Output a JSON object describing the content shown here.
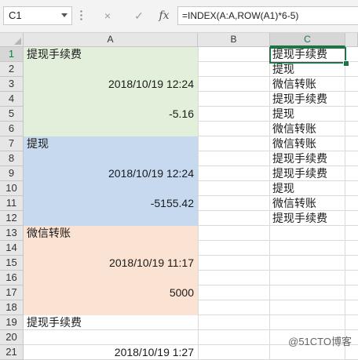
{
  "formula_bar": {
    "name_box": "C1",
    "cancel_icon": "×",
    "enter_icon": "✓",
    "fx_label": "fx",
    "formula": "=INDEX(A:A,ROW(A1)*6-5)"
  },
  "columns": [
    "A",
    "B",
    "C"
  ],
  "rows": [
    "1",
    "2",
    "3",
    "4",
    "5",
    "6",
    "7",
    "8",
    "9",
    "10",
    "11",
    "12",
    "13",
    "14",
    "15",
    "16",
    "17",
    "18",
    "19",
    "20",
    "21"
  ],
  "column_a": [
    {
      "row": 1,
      "text": "提现手续费",
      "align": "left"
    },
    {
      "row": 3,
      "text": "2018/10/19 12:24",
      "align": "right"
    },
    {
      "row": 5,
      "text": "-5.16",
      "align": "right"
    },
    {
      "row": 7,
      "text": "提现",
      "align": "left"
    },
    {
      "row": 9,
      "text": "2018/10/19 12:24",
      "align": "right"
    },
    {
      "row": 11,
      "text": "-5155.42",
      "align": "right"
    },
    {
      "row": 13,
      "text": "微信转账",
      "align": "left"
    },
    {
      "row": 15,
      "text": "2018/10/19 11:17",
      "align": "right"
    },
    {
      "row": 17,
      "text": "5000",
      "align": "right"
    },
    {
      "row": 19,
      "text": "提现手续费",
      "align": "left"
    },
    {
      "row": 21,
      "text": "2018/10/19 1:27",
      "align": "right"
    }
  ],
  "column_c": [
    "提现手续费",
    "提现",
    "微信转账",
    "提现手续费",
    "提现",
    "微信转账",
    "微信转账",
    "提现手续费",
    "提现手续费",
    "提现",
    "微信转账",
    "提现手续费"
  ],
  "active_cell": "C1",
  "watermark": "@51CTO博客",
  "colors": {
    "accent": "#217346",
    "fill_green": "#e2efda",
    "fill_blue": "#c6d9ef",
    "fill_orange": "#fbe3d3"
  }
}
